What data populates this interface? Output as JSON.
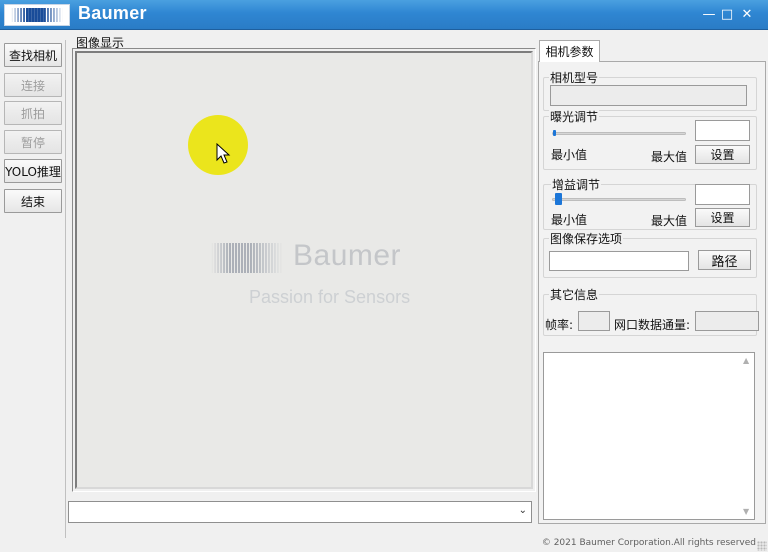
{
  "window": {
    "title": "Baumer",
    "controls": [
      "minimize-icon",
      "maximize-icon",
      "close-icon"
    ]
  },
  "left_buttons": [
    {
      "label": "查找相机",
      "enabled": true
    },
    {
      "label": "连接",
      "enabled": false
    },
    {
      "label": "抓拍",
      "enabled": false
    },
    {
      "label": "暂停",
      "enabled": false
    },
    {
      "label": "YOLO推理",
      "enabled": true
    },
    {
      "label": "结束",
      "enabled": true
    }
  ],
  "image_panel": {
    "label": "图像显示",
    "watermark_name": "Baumer",
    "watermark_tagline": "Passion for Sensors"
  },
  "combo": {
    "value": ""
  },
  "tabs": [
    {
      "label": "相机参数",
      "active": true
    }
  ],
  "camera_params": {
    "model_label": "相机型号",
    "model_value": "",
    "exposure": {
      "label": "曝光调节",
      "min_label": "最小值",
      "max_label": "最大值",
      "set_button": "设置",
      "value": "",
      "level": 0.0
    },
    "gain": {
      "label": "增益调节",
      "min_label": "最小值",
      "max_label": "最大值",
      "set_button": "设置",
      "value": "",
      "level": 0.0
    },
    "save": {
      "label": "图像保存选项",
      "path_value": "",
      "path_button": "路径"
    },
    "other": {
      "label": "其它信息",
      "fps_label": "帧率:",
      "fps_value": "",
      "throughput_label": "网口数据通量:",
      "throughput_value": ""
    }
  },
  "log_text": "",
  "status": {
    "copyright": "© 2021 Baumer Corporation.All rights reserved"
  },
  "colors": {
    "titlebar": "#2f86d2",
    "highlight": "#ebe51c",
    "slider_thumb": "#1c76d8"
  }
}
